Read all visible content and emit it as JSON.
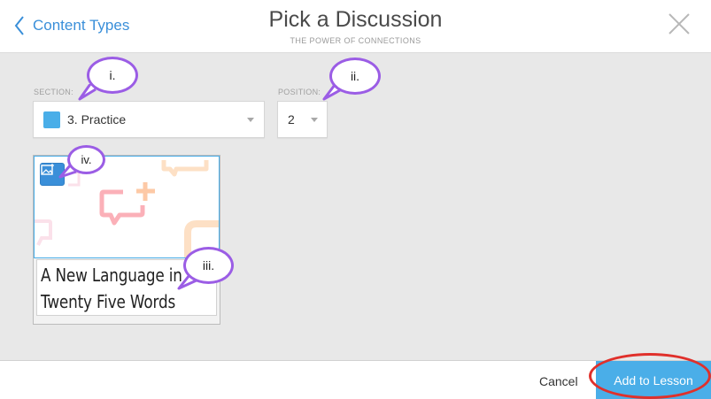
{
  "header": {
    "back_label": "Content Types",
    "title": "Pick a Discussion",
    "subtitle": "THE POWER OF CONNECTIONS",
    "back_icon": "chevron-left-icon",
    "close_icon": "close-icon"
  },
  "form": {
    "section_label": "SECTION:",
    "section_value": "3. Practice",
    "section_color": "#4aaee8",
    "position_label": "POSITION:",
    "position_value": "2"
  },
  "card": {
    "title": "A New Language in Twenty Five Words",
    "image_button_icon": "add-image-icon"
  },
  "annotations": {
    "section": "i.",
    "position": "ii.",
    "title": "iii.",
    "image": "iv.",
    "callout_color": "#9b5de5",
    "highlight_color": "#e0302b"
  },
  "footer": {
    "cancel_label": "Cancel",
    "add_label": "Add to Lesson",
    "accent": "#4aaee8"
  }
}
